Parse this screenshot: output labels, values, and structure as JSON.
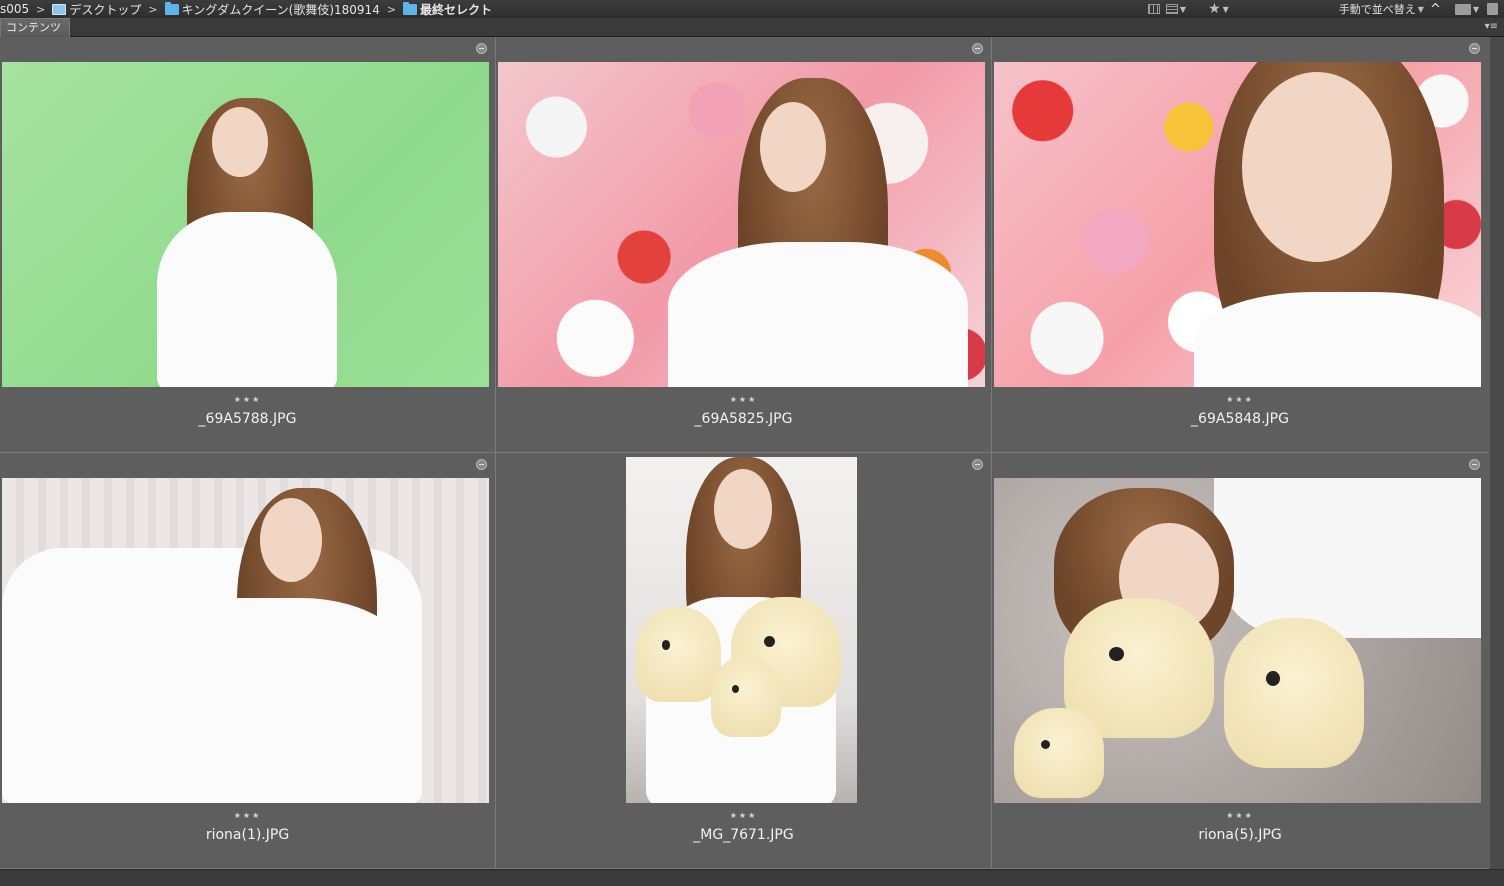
{
  "breadcrumb": [
    {
      "label": "s005",
      "icon": "none",
      "bold": false
    },
    {
      "label": "デスクトップ",
      "icon": "desktop-icon",
      "bold": false
    },
    {
      "label": "キングダムクイーン(歌舞伎)180914",
      "icon": "folder-icon",
      "bold": false
    },
    {
      "label": "最終セレクト",
      "icon": "folder-icon",
      "bold": true
    }
  ],
  "toolbar": {
    "sort_label": "手動で並べ替え"
  },
  "panel": {
    "tab_label": "コンテンツ"
  },
  "thumbnails": [
    {
      "filename": "_69A5788.JPG",
      "rating": "★★★",
      "scene": "green"
    },
    {
      "filename": "_69A5825.JPG",
      "rating": "★★★",
      "scene": "flowers"
    },
    {
      "filename": "_69A5848.JPG",
      "rating": "★★★",
      "scene": "flowers-close"
    },
    {
      "filename": "riona(1).JPG",
      "rating": "★★★",
      "scene": "sofa"
    },
    {
      "filename": "_MG_7671.JPG",
      "rating": "★★★",
      "scene": "plush-portrait"
    },
    {
      "filename": "riona(5).JPG",
      "rating": "★★★",
      "scene": "plush-lying"
    }
  ],
  "colors": {
    "content_bg": "#5e5e5e",
    "folder_blue": "#5fb3e6"
  }
}
